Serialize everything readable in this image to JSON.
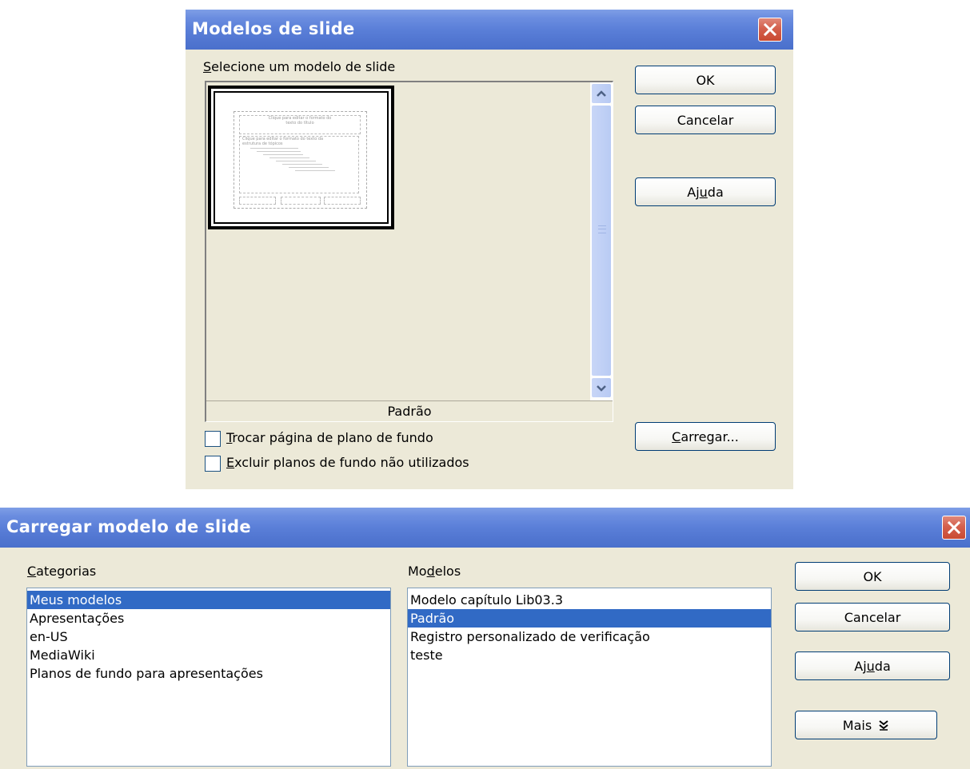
{
  "dialog1": {
    "title": "Modelos de slide",
    "select_label": {
      "u": "S",
      "rest": "elecione um modelo de slide"
    },
    "preview_name": "Padrão",
    "preview_lines": [
      "Clique para editar o formato do",
      "texto do título",
      "Clique para editar o formato do texto da",
      "estrutura de tópicos"
    ],
    "checkbox1": {
      "u": "T",
      "rest": "rocar página de plano de fundo",
      "checked": false
    },
    "checkbox2": {
      "u": "E",
      "rest": "xcluir planos de fundo não utilizados",
      "checked": false
    },
    "ok": "OK",
    "cancel": "Cancelar",
    "help": {
      "pre": "Aj",
      "u": "u",
      "post": "da"
    },
    "load": {
      "u": "C",
      "rest": "arregar..."
    }
  },
  "dialog2": {
    "title": "Carregar modelo de slide",
    "categories_label": {
      "u": "C",
      "rest": "ategorias"
    },
    "models_label": {
      "pre": "Mo",
      "u": "d",
      "post": "elos"
    },
    "categories": [
      "Meus modelos",
      "Apresentações",
      "en-US",
      "MediaWiki",
      "Planos de fundo para apresentações"
    ],
    "categories_selected": 0,
    "models": [
      "Modelo capítulo Lib03.3",
      "Padrão",
      "Registro personalizado de verificação",
      "teste"
    ],
    "models_selected": 1,
    "ok": "OK",
    "cancel": "Cancelar",
    "help": {
      "pre": "Aj",
      "u": "u",
      "post": "da"
    },
    "more": "Mais",
    "more_icon": "double-chevron-down-icon"
  },
  "colors": {
    "title_bar": "#5a7fd8",
    "dialog_bg": "#ece9d8",
    "selection": "#316ac5",
    "close_button": "#d4604d"
  }
}
